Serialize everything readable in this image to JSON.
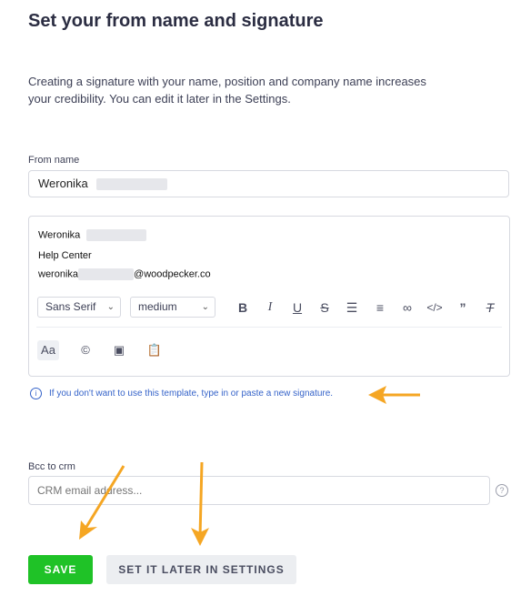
{
  "page": {
    "title": "Set your from name and signature",
    "description": "Creating a signature with your name, position and company name increases your credibility. You can edit it later in the Settings."
  },
  "from_name": {
    "label": "From name",
    "value": "Weronika"
  },
  "signature": {
    "name": "Weronika",
    "position": "Help Center",
    "email_prefix": "weronika",
    "email_domain": "@woodpecker.co"
  },
  "toolbar": {
    "font": "Sans Serif",
    "size": "medium",
    "icons": [
      "bold-icon",
      "italic-icon",
      "underline-icon",
      "strikethrough-icon",
      "bullet-list-icon",
      "align-icon",
      "link-icon",
      "code-icon",
      "quote-icon",
      "clear-format-icon"
    ],
    "icons_row2": [
      "text-style-icon",
      "copyright-icon",
      "image-icon",
      "paste-template-icon"
    ]
  },
  "hint": {
    "text": "If you don't want to use this template, type in or paste a new signature."
  },
  "bcc": {
    "label": "Bcc to crm",
    "placeholder": "CRM email address..."
  },
  "buttons": {
    "save": "SAVE",
    "later": "SET IT LATER IN SETTINGS"
  },
  "colors": {
    "save_bg": "#1fc227",
    "arrow": "#f5a623",
    "hint": "#3563c9"
  }
}
